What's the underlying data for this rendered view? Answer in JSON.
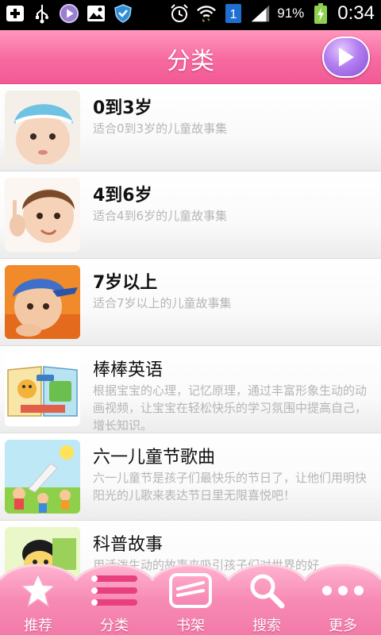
{
  "status_bar": {
    "battery_percent": "91%",
    "time": "0:34",
    "sim_slot": "1",
    "icons": [
      "add-icon",
      "usb-icon",
      "media-play-icon",
      "image-icon",
      "shield-icon",
      "alarm-icon",
      "wifi-icon",
      "sim-1-icon",
      "signal-icon",
      "battery-icon"
    ]
  },
  "header": {
    "title": "分类",
    "play_button_icon": "play-icon"
  },
  "categories": [
    {
      "title": "0到3岁",
      "desc": "适合0到3岁的儿童故事集",
      "bold": true,
      "thumb": "baby-blue-hat"
    },
    {
      "title": "4到6岁",
      "desc": "适合4到6岁的儿童故事集",
      "bold": true,
      "thumb": "toddler-girl"
    },
    {
      "title": "7岁以上",
      "desc": "适合7岁以上的儿童故事集",
      "bold": true,
      "thumb": "boy-blue-cap"
    },
    {
      "title": "棒棒英语",
      "desc": "根据宝宝的心理，记忆原理，通过丰富形象生动的动画视频，让宝宝在轻松快乐的学习氛围中提高自己，增长知识。",
      "bold": false,
      "thumb": "english-book"
    },
    {
      "title": "六一儿童节歌曲",
      "desc": "六一儿童节是孩子们最快乐的节日了，让他们用明快阳光的儿歌来表达节日里无限喜悦吧！",
      "bold": false,
      "thumb": "kids-playground"
    },
    {
      "title": "科普故事",
      "desc": "用活泼生动的故事来吸引孩子们对世界的好",
      "bold": false,
      "thumb": "cartoon-character"
    }
  ],
  "bottom_nav": [
    {
      "label": "推荐",
      "icon": "star-icon"
    },
    {
      "label": "分类",
      "icon": "list-icon",
      "active": true
    },
    {
      "label": "书架",
      "icon": "bookshelf-icon"
    },
    {
      "label": "搜索",
      "icon": "search-icon"
    },
    {
      "label": "更多",
      "icon": "more-icon"
    }
  ],
  "colors": {
    "header_pink": "#f76aa0",
    "nav_pink": "#f58bb4",
    "title_text": "#111111",
    "desc_text": "#b5b5b5"
  }
}
